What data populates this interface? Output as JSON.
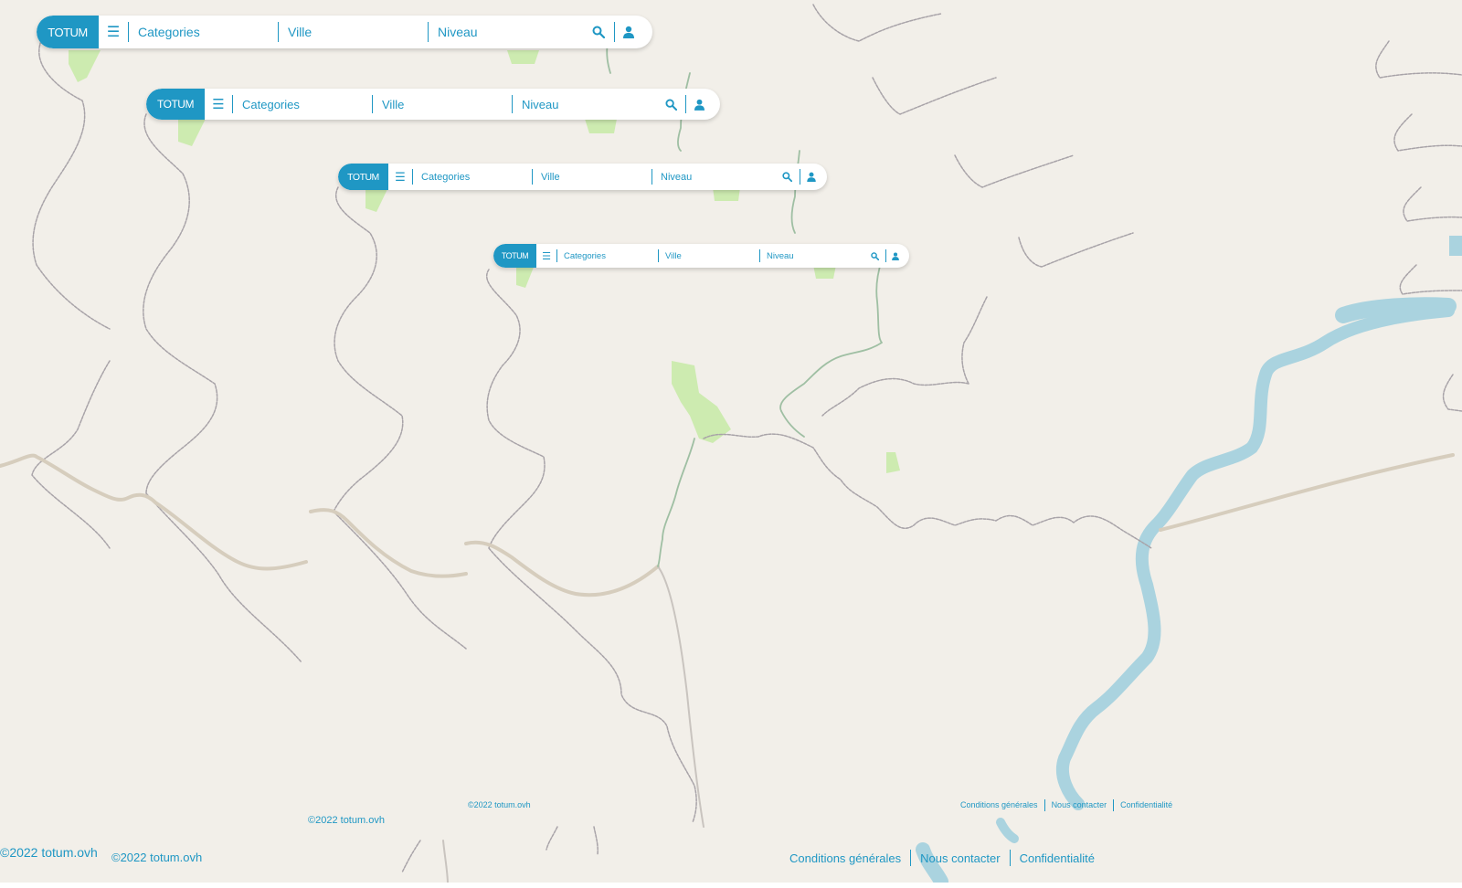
{
  "colors": {
    "accent": "#1f97c4",
    "map_bg": "#f2efe9",
    "river": "#aad3df",
    "park": "#cdebb0",
    "border": "#a8a3a8"
  },
  "bars": [
    {
      "brand": "TOTUM",
      "categories": "Categories",
      "ville": "Ville",
      "niveau": "Niveau",
      "search_icon": "search-icon",
      "user_icon": "user-icon",
      "menu_icon": "menu-icon"
    },
    {
      "brand": "TOTUM",
      "categories": "Categories",
      "ville": "Ville",
      "niveau": "Niveau",
      "search_icon": "search-icon",
      "user_icon": "user-icon",
      "menu_icon": "menu-icon"
    },
    {
      "brand": "TOTUM",
      "categories": "Categories",
      "ville": "Ville",
      "niveau": "Niveau",
      "search_icon": "search-icon",
      "user_icon": "user-icon",
      "menu_icon": "menu-icon"
    },
    {
      "brand": "TOTUM",
      "categories": "Categories",
      "ville": "Ville",
      "niveau": "Niveau",
      "search_icon": "search-icon",
      "user_icon": "user-icon",
      "menu_icon": "menu-icon"
    }
  ],
  "copyrights": [
    "©2022 totum.ovh",
    "©2022 totum.ovh",
    "©2022 totum.ovh",
    "©2022 totum.ovh"
  ],
  "legal_links": [
    {
      "conditions": "Conditions générales",
      "contact": "Nous contacter",
      "privacy": "Confidentialité"
    },
    {
      "conditions": "Conditions générales",
      "contact": "Nous contacter",
      "privacy": "Confidentialité"
    }
  ]
}
